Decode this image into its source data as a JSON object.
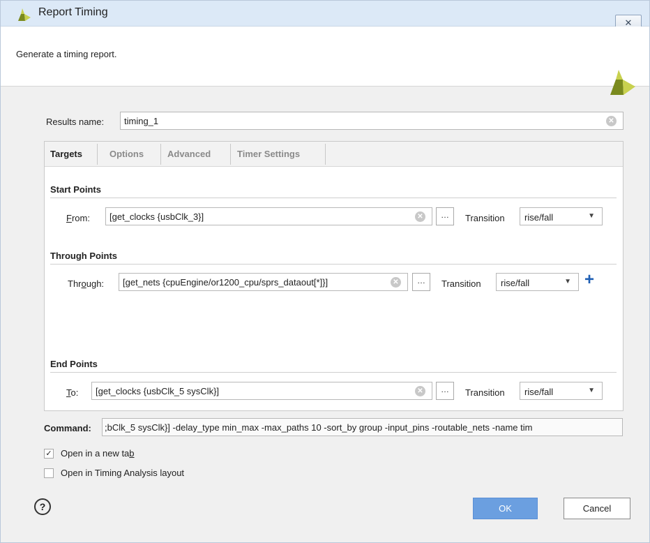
{
  "window": {
    "title": "Report Timing",
    "close_label": "✕"
  },
  "header": {
    "description": "Generate a timing report."
  },
  "results": {
    "label": "Results name:",
    "value": "timing_1"
  },
  "tabs": [
    {
      "label": "Targets",
      "active": true
    },
    {
      "label": "Options",
      "active": false
    },
    {
      "label": "Advanced",
      "active": false
    },
    {
      "label": "Timer Settings",
      "active": false
    }
  ],
  "start_points": {
    "title": "Start Points",
    "from_label_u": "F",
    "from_label_rest": "rom:",
    "from_value": "[get_clocks {usbClk_3}]",
    "transition_label": "Transition",
    "transition_value": "rise/fall"
  },
  "through_points": {
    "title": "Through Points",
    "through_label_pre": "Thr",
    "through_label_u": "o",
    "through_label_post": "ugh:",
    "through_value": "[get_nets {cpuEngine/or1200_cpu/sprs_dataout[*]}]",
    "transition_label": "Transition",
    "transition_value": "rise/fall",
    "add_label": "+"
  },
  "end_points": {
    "title": "End Points",
    "to_label_u": "T",
    "to_label_rest": "o:",
    "to_value": "[get_clocks {usbClk_5 sysClk}]",
    "transition_label": "Transition",
    "transition_value": "rise/fall"
  },
  "dots_label": "…",
  "command": {
    "label": "Command:",
    "value": ";bClk_5 sysClk}] -delay_type min_max -max_paths 10 -sort_by group -input_pins -routable_nets -name tim"
  },
  "options": {
    "new_tab_pre": "Open in a new ta",
    "new_tab_u": "b",
    "new_tab_checked": true,
    "timing_layout": "Open in Timing Analysis layout",
    "timing_layout_checked": false
  },
  "buttons": {
    "help": "?",
    "ok": "OK",
    "cancel": "Cancel"
  },
  "colors": {
    "accent": "#6b9fe0",
    "titlebar": "#dce9f7",
    "plus": "#1f5fb4",
    "logo_light": "#c8d14f",
    "logo_dark": "#7a8a1e"
  }
}
